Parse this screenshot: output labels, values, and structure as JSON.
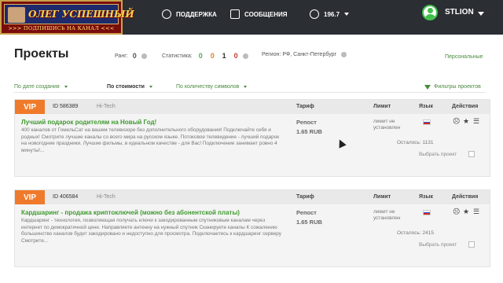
{
  "banner": {
    "name": "ОЛЕГ УСПЕШНЫЙ",
    "subtitle": ">>> ПОДПИШИСЬ НА КАНАЛ <<<"
  },
  "header": {
    "nav": [
      {
        "label": "ПОДДЕРЖКА",
        "icon": "gear-icon"
      },
      {
        "label": "СООБЩЕНИЯ",
        "icon": "message-plus-icon"
      }
    ],
    "balance": "196.7",
    "user": "STLION"
  },
  "page": {
    "title": "Проекты",
    "rank_label": "Ранг:",
    "rank_value": "0",
    "stats_label": "Статистика:",
    "stats": [
      "0",
      "0",
      "1",
      "0"
    ],
    "region": "Регион: РФ, Санкт-Петербург",
    "personal_link": "Персональные"
  },
  "filters": {
    "by_date": "По дате создания",
    "by_cost": "По стоимости",
    "by_chars": "По количеству символов",
    "project_filters": "Фильтры проектов"
  },
  "columns": {
    "tariff": "Тариф",
    "limit": "Лимит",
    "lang": "Язык",
    "actions": "Действия"
  },
  "projects": [
    {
      "badge": "VIP",
      "id": "ID 586389",
      "category": "Hi-Tech",
      "title": "Лучший подарок родителям на Новый Год!",
      "description": "400 каналов от ГомельСат на вашем телевизоре без дополнительного оборудования! Подключайте себя и родных! Смотрите лучшие каналы со всего мира на русском языке. Потоковое телевидение - лучший подарок на новогодние праздники. Лучшие фильмы, в идеальном качестве - для Вас! Подключение занимает ровно 4 минуты!...",
      "tariff": "Репост",
      "price": "1.65 RUB",
      "limit": "лимит не установлен",
      "remaining": "Осталось: 1131",
      "choose": "Выбрать проект"
    },
    {
      "badge": "VIP",
      "id": "ID 406584",
      "category": "Hi-Tech",
      "title": "Кардшаринг - продажа криптоключей (можно без абонентской платы)",
      "description": "Кардшаринг - технология, позволяющая получать ключи к закодированным спутниковым каналам через интернет по демократичной цене. Направляете антенну на нужный спутник Сканируете каналы К сожалению большинство каналов будет закодировано и недоступно для просмотра. Подключаетесь к кардшаринг серверу Смотрите...",
      "tariff": "Репост",
      "price": "1.65 RUB",
      "limit": "лимит не установлен",
      "remaining": "Осталось: 2415",
      "choose": "Выбрать проект"
    }
  ],
  "colors": {
    "accent_green": "#3f9a2f",
    "vip_orange": "#f07a2b",
    "header_bg": "#2b2e33"
  }
}
